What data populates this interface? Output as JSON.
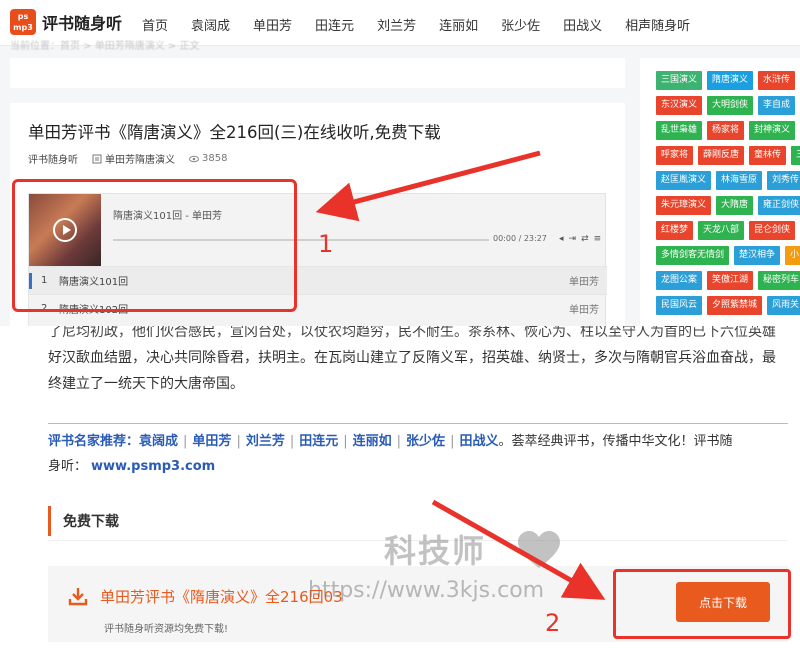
{
  "site": {
    "logo_mark": "ps mp3",
    "logo_text": "评书随身听"
  },
  "nav": [
    "首页",
    "袁阔成",
    "单田芳",
    "田连元",
    "刘兰芳",
    "连丽如",
    "张少佐",
    "田战义",
    "相声随身听"
  ],
  "breadcrumb": "当前位置：首页 > 单田芳隋唐演义 > 正文",
  "article": {
    "title": "单田芳评书《隋唐演义》全216回(三)在线收听,免费下载",
    "author": "评书随身听",
    "category": "单田芳隋唐演义",
    "views": "3858"
  },
  "player": {
    "now_playing": "隋唐演义101回 - 单田芳",
    "time": "00:00 / 23:27",
    "playlist": [
      {
        "num": "1",
        "name": "隋唐演义101回",
        "artist": "单田芳"
      },
      {
        "num": "2",
        "name": "隋唐演义102回",
        "artist": "单田芳"
      }
    ]
  },
  "sidebar_tags": [
    [
      {
        "t": "三国演义",
        "c": "#3cb371"
      },
      {
        "t": "隋唐演义",
        "c": "#1a9fe0"
      },
      {
        "t": "水浒传",
        "c": "#e8452c"
      }
    ],
    [
      {
        "t": "东汉演义",
        "c": "#e8452c"
      },
      {
        "t": "大明剑侠",
        "c": "#2fb350"
      },
      {
        "t": "李自成",
        "c": "#2a9fd8"
      }
    ],
    [
      {
        "t": "乱世枭雄",
        "c": "#2fb350"
      },
      {
        "t": "杨家将",
        "c": "#e8452c"
      },
      {
        "t": "封神演义",
        "c": "#2fb350"
      }
    ],
    [
      {
        "t": "呼家将",
        "c": "#e8452c"
      },
      {
        "t": "薛刚反唐",
        "c": "#e8452c"
      },
      {
        "t": "童林传",
        "c": "#e8452c"
      },
      {
        "t": "三",
        "c": "#2fb350"
      }
    ],
    [
      {
        "t": "赵匡胤演义",
        "c": "#2a9fd8"
      },
      {
        "t": "林海雪原",
        "c": "#2a9fd8"
      },
      {
        "t": "刘秀传",
        "c": "#2a9fd8"
      }
    ],
    [
      {
        "t": "朱元璋演义",
        "c": "#e8452c"
      },
      {
        "t": "大隋唐",
        "c": "#2fb350"
      },
      {
        "t": "雍正剑侠",
        "c": "#2a9fd8"
      }
    ],
    [
      {
        "t": "红楼梦",
        "c": "#e8452c"
      },
      {
        "t": "天龙八部",
        "c": "#2fb350"
      },
      {
        "t": "昆仑剑侠",
        "c": "#e8452c"
      }
    ],
    [
      {
        "t": "多情剑客无情剑",
        "c": "#2fb350"
      },
      {
        "t": "楚汉相争",
        "c": "#2a9fd8"
      },
      {
        "t": "小",
        "c": "#f39c12"
      }
    ],
    [
      {
        "t": "龙图公案",
        "c": "#2a9fd8"
      },
      {
        "t": "笑傲江湖",
        "c": "#e8452c"
      },
      {
        "t": "秘密列车",
        "c": "#2fb350"
      }
    ],
    [
      {
        "t": "民国风云",
        "c": "#2a9fd8"
      },
      {
        "t": "夕照紫禁城",
        "c": "#e8452c"
      },
      {
        "t": "风雨关",
        "c": "#2a9fd8"
      }
    ]
  ],
  "annotations": {
    "label1": "1",
    "label2": "2"
  },
  "body": {
    "line0": "了尼均初政，他们伙合感民，宣冈台处，以仗农均趋穷，民不耐生。茶系林、恢心为、柱以至守人为首的已下六位英雄",
    "line1": "好汉歃血结盟，决心共同除昏君，扶明主。在瓦岗山建立了反隋义军，招英雄、纳贤士，多次与隋朝官兵浴血奋战，最",
    "line2": "终建立了一统天下的大唐帝国。"
  },
  "recommend": {
    "prefix": "评书名家推荐：",
    "names": [
      "袁阔成",
      "单田芳",
      "刘兰芳",
      "田连元",
      "连丽如",
      "张少佐",
      "田战义"
    ],
    "suffix": "。荟萃经典评书，传播中华文化！评书随",
    "line2_prefix": "身听：",
    "url": "www.psmp3.com"
  },
  "download": {
    "section_title": "免费下载",
    "title": "单田芳评书《隋唐演义》全216回03",
    "subtitle": "评书随身听资源均免费下载!",
    "button": "点击下载"
  },
  "watermark": {
    "text": "科技师",
    "url": "https://www.3kjs.com"
  }
}
